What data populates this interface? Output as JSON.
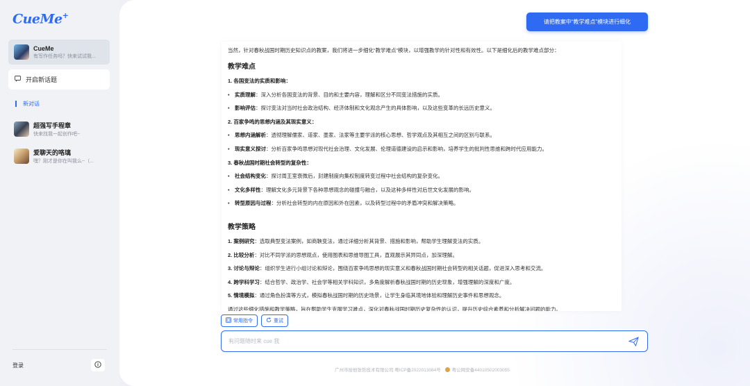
{
  "app": {
    "logo": "CueMe",
    "logo_mark": "+"
  },
  "sidebar": {
    "bot": {
      "name": "CueMe",
      "subtitle": "有写作任务吗？快来试试我..."
    },
    "new_topic": "开启新话题",
    "conversation_label": "新对话",
    "history": [
      {
        "name": "超强写手程章",
        "subtitle": "快来找我一起创作吧~"
      },
      {
        "name": "爱聊天的咯璃",
        "subtitle": "嘿？刚才是你在叫我么~（..."
      }
    ],
    "login": "登录"
  },
  "chat": {
    "user_message": "请把教案中“教学难点”模块进行细化",
    "intro": "当然，针对春秋战国时期历史知识点的教案，我们将进一步细化“教学难点”模块，以增强教学的针对性和有效性。以下是细化后的教学难点部分：",
    "section1_title": "教学难点",
    "section1": [
      {
        "kind": "num",
        "bold": "1. 各国变法的实质和影响：",
        "text": ""
      },
      {
        "kind": "bul",
        "bold": "实质理解",
        "text": "：深入分析各国变法的背景、目的和主要内容，理解和区分不同变法措施的实质。"
      },
      {
        "kind": "bul",
        "bold": "影响评估",
        "text": "：探讨变法对当时社会政治结构、经济体制和文化观念产生的具体影响，以及这些变革的长远历史意义。"
      },
      {
        "kind": "num",
        "bold": "2. 百家争鸣的思想内涵及其现实意义：",
        "text": ""
      },
      {
        "kind": "bul",
        "bold": "思想内涵解析",
        "text": "：透彻理解儒家、道家、墨家、法家等主要学派的核心思想、哲学观点及其相互之间的区别与联系。"
      },
      {
        "kind": "bul",
        "bold": "现实意义探讨",
        "text": "：分析百家争鸣思想对现代社会治理、文化发展、伦理道德建设的启示和影响，培养学生的批判性思维和跨时代应用能力。"
      },
      {
        "kind": "num",
        "bold": "3. 春秋战国时期社会转型的复杂性：",
        "text": ""
      },
      {
        "kind": "bul",
        "bold": "社会结构变化",
        "text": "：探讨周王室衰微后，封建制度向集权制度转变过程中社会结构的复杂变化。"
      },
      {
        "kind": "bul",
        "bold": "文化多样性",
        "text": "：理解文化多元背景下各种思想观念的碰撞与融合，以及这种多样性对后世文化发展的影响。"
      },
      {
        "kind": "bul",
        "bold": "转型原因与过程",
        "text": "：分析社会转型的内在原因和外在因素，以及转型过程中的矛盾冲突和解决策略。"
      }
    ],
    "section2_title": "教学策略",
    "section2": [
      {
        "bold": "1. 案例研究",
        "text": "：选取典型变法案例，如商鞅变法，通过详细分析其背景、措施和影响，帮助学生理解变法的实质。"
      },
      {
        "bold": "2. 比较分析",
        "text": "：对比不同学派的思想观点，使用图表和思维导图工具，直观展示其异同点，加深理解。"
      },
      {
        "bold": "3. 讨论与辩论",
        "text": "：组织学生进行小组讨论和辩论，围绕百家争鸣思想的现实意义和春秋战国时期社会转型的相关话题，促进深入思考和交流。"
      },
      {
        "bold": "4. 跨学科学习",
        "text": "：结合哲学、政治学、社会学等相关学科知识，多角度解析春秋战国时期的历史现象，增强理解的深度和广度。"
      },
      {
        "bold": "5. 情境模拟",
        "text": "：通过角色扮演等方式，模拟春秋战国时期的历史场景，让学生身临其境地体验和理解历史事件和思想观念。"
      }
    ],
    "summary": "通过这些细化措施和教学策略，旨在帮助学生克服学习难点，深化对春秋战国时期历史复杂性的认识，提升历史综合素养和分析解决问题的能力。",
    "actions": {
      "commands": "常用指令",
      "retry": "重试"
    },
    "input_placeholder": "有问题随时来 cue 我"
  },
  "footer": {
    "company": "广州市拾他张哲技术有限公司 粤ICP备2022013084号",
    "police": "粤公网安备44010502003055"
  },
  "colors": {
    "accent": "#2f6bf2",
    "sidebar_bg": "#f1f2f6"
  }
}
